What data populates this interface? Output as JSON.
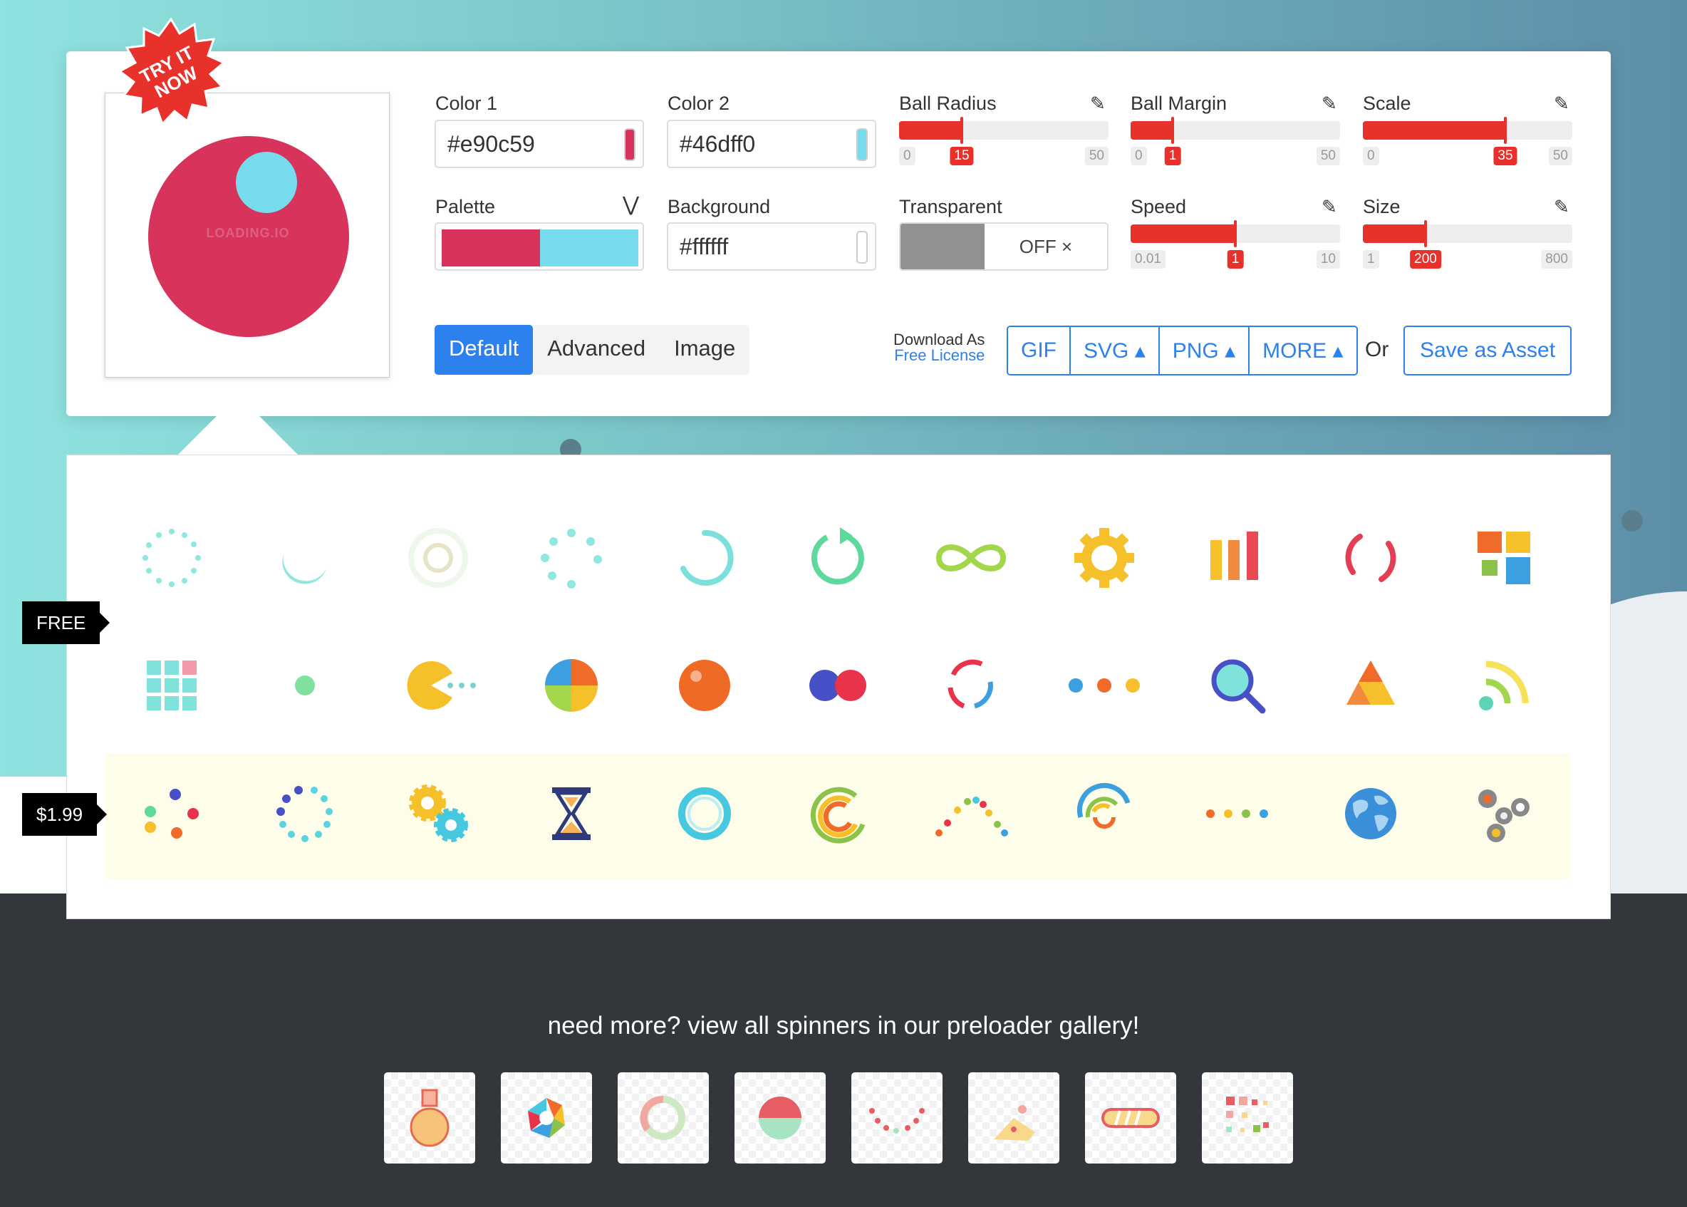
{
  "badge": {
    "line1": "TRY IT",
    "line2": "NOW"
  },
  "preview": {
    "watermark": "LOADING.IO",
    "color1": "#d7335b",
    "color2": "#76dbec"
  },
  "fields": {
    "color1": {
      "label": "Color 1",
      "value": "#e90c59"
    },
    "color2": {
      "label": "Color 2",
      "value": "#46dff0"
    },
    "palette": {
      "label": "Palette",
      "colors": [
        "#d7335b",
        "#76dbec"
      ]
    },
    "background": {
      "label": "Background",
      "value": "#ffffff"
    },
    "transparent": {
      "label": "Transparent",
      "state": "OFF ×"
    }
  },
  "sliders": {
    "ball_radius": {
      "label": "Ball Radius",
      "min": "0",
      "max": "50",
      "value": "15",
      "fraction": 0.3
    },
    "ball_margin": {
      "label": "Ball Margin",
      "min": "0",
      "max": "50",
      "value": "1",
      "fraction": 0.2
    },
    "scale": {
      "label": "Scale",
      "min": "0",
      "max": "50",
      "value": "35",
      "fraction": 0.68
    },
    "speed": {
      "label": "Speed",
      "min": "0.01",
      "max": "10",
      "value": "1",
      "fraction": 0.5
    },
    "size": {
      "label": "Size",
      "min": "1",
      "max": "800",
      "value": "200",
      "fraction": 0.3
    }
  },
  "tabs": [
    "Default",
    "Advanced",
    "Image"
  ],
  "download": {
    "label": "Download As",
    "license": "Free License",
    "buttons": [
      "GIF",
      "SVG ▴",
      "PNG ▴",
      "MORE ▴"
    ],
    "or": "Or",
    "save": "Save as Asset"
  },
  "tags": {
    "free": "FREE",
    "paid": "$1.99"
  },
  "gallery_text": "need more? view all spinners in our preloader gallery!",
  "icons": {
    "row1": [
      "dotted-circle-spinner-icon",
      "crescent-spinner-icon",
      "ring-spinner-icon",
      "dot-burst-spinner-icon",
      "arc-spinner-icon",
      "refresh-arrow-icon",
      "infinity-icon",
      "gear-icon",
      "bars-icon",
      "dashed-ring-spinner-icon",
      "blocks-icon"
    ],
    "row2": [
      "grid-icon",
      "dot-icon",
      "pacman-icon",
      "pie-icon",
      "orange-ball-icon",
      "two-balls-icon",
      "circle-arrows-icon",
      "ellipsis-dots-icon",
      "magnifier-icon",
      "triangle-icon",
      "wifi-icon"
    ],
    "row3": [
      "four-dots-icon",
      "dotted-ring-icon",
      "gears-icon",
      "hourglass-icon",
      "ring-icon",
      "rainbow-arc-icon",
      "dot-wave-icon",
      "double-arc-icon",
      "dot-row-icon",
      "globe-icon",
      "fidget-spinner-icon"
    ]
  },
  "thumbs": [
    "flask-icon",
    "aperture-icon",
    "donut-icon",
    "half-ball-icon",
    "dot-arc-icon",
    "cake-icon",
    "progress-bar-icon",
    "pixel-squares-icon"
  ]
}
